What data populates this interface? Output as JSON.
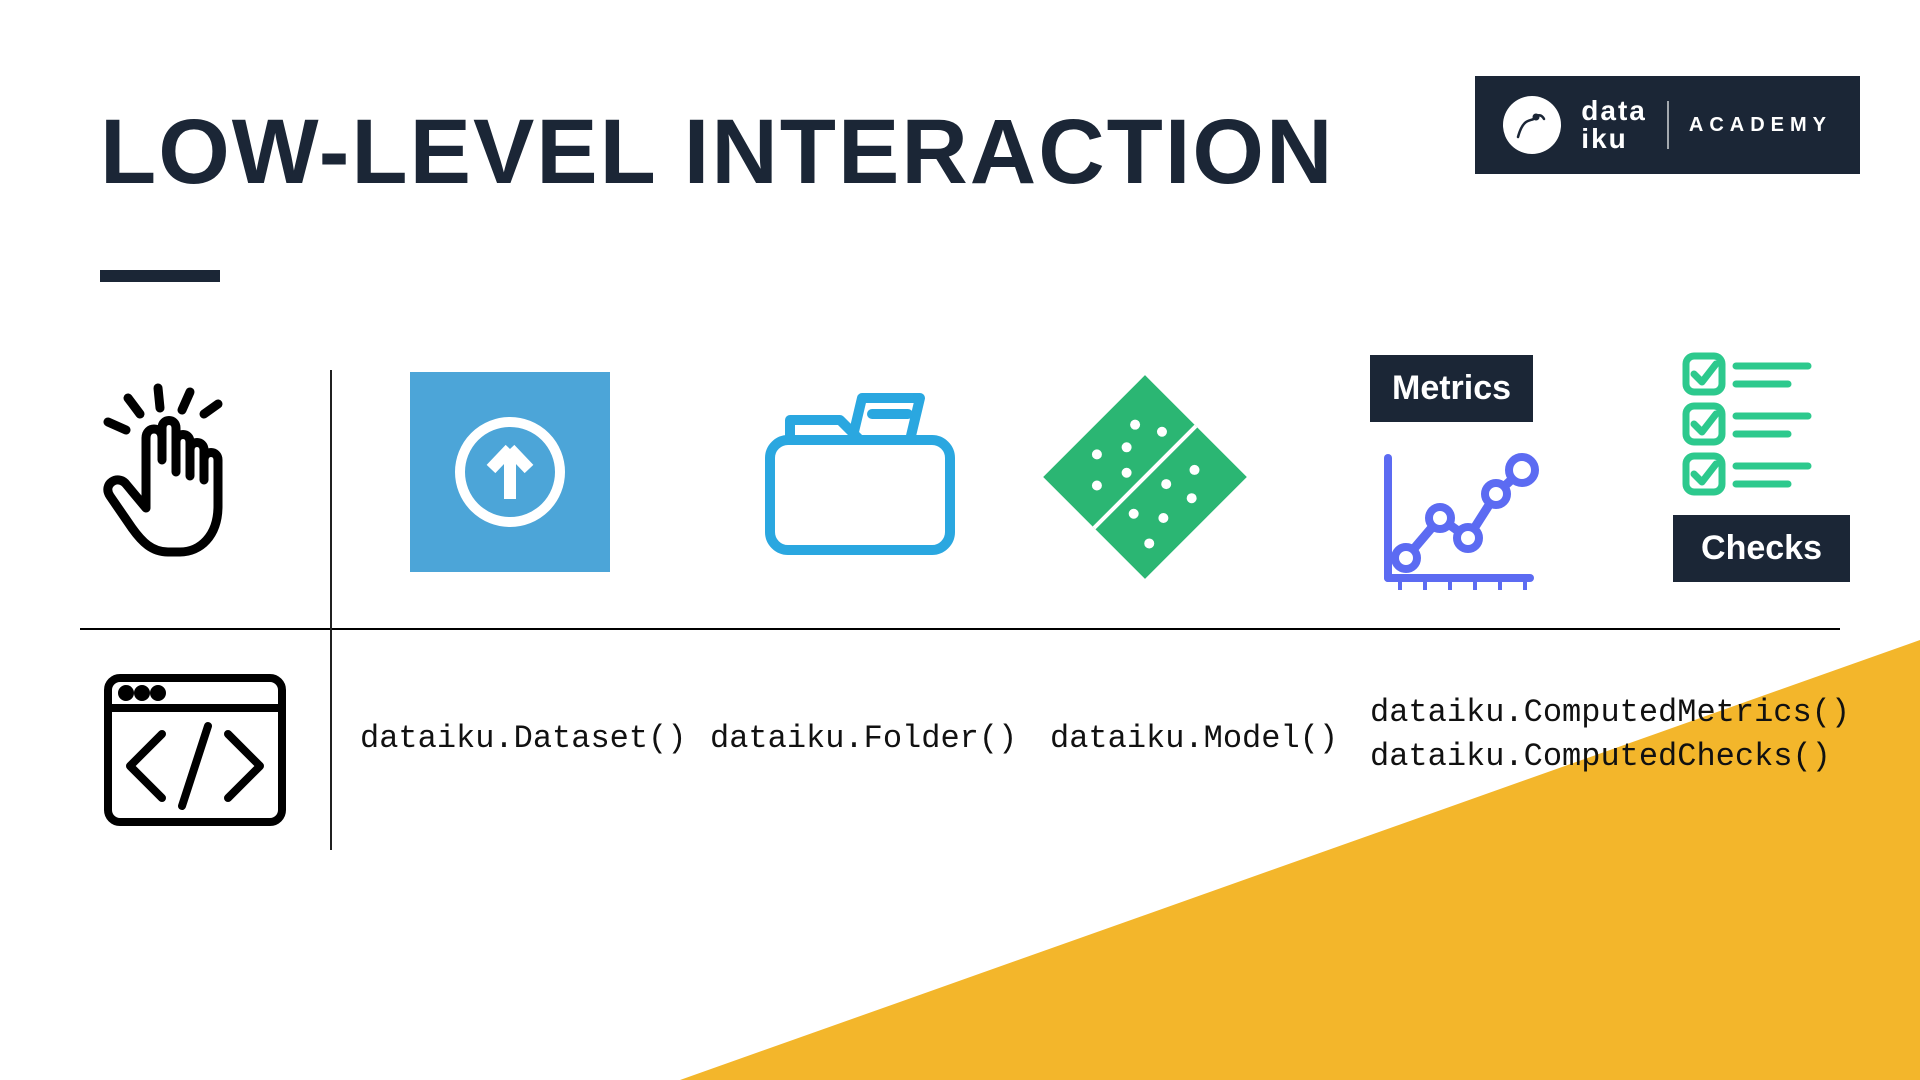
{
  "title": "LOW-LEVEL INTERACTION",
  "logo": {
    "brand_line1": "data",
    "brand_line2": "iku",
    "tagline": "ACADEMY"
  },
  "badges": {
    "metrics": "Metrics",
    "checks": "Checks"
  },
  "code": {
    "dataset": "dataiku.Dataset()",
    "folder": "dataiku.Folder()",
    "model": "dataiku.Model()",
    "metrics": "dataiku.ComputedMetrics()",
    "checks": "dataiku.ComputedChecks()"
  },
  "colors": {
    "dark": "#1b2636",
    "yellow": "#f3b62b",
    "blue": "#4ca5d8",
    "green": "#2bb673",
    "chartblue": "#5c6bf2",
    "mint": "#2dc98d"
  }
}
